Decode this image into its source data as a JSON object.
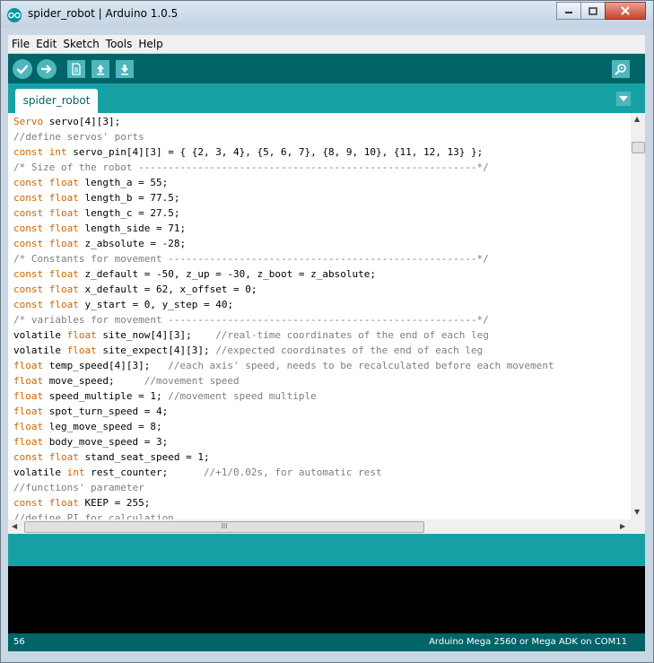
{
  "window": {
    "title": "spider_robot | Arduino 1.0.5",
    "icon": "arduino-logo-icon"
  },
  "window_buttons": {
    "minimize": "minimize-icon",
    "maximize": "maximize-icon",
    "close": "close-icon"
  },
  "menu": [
    "File",
    "Edit",
    "Sketch",
    "Tools",
    "Help"
  ],
  "toolbar": {
    "buttons": [
      "verify-icon",
      "upload-icon",
      "new-icon",
      "open-icon",
      "save-icon"
    ],
    "serial_monitor": "serial-monitor-icon"
  },
  "tabs": [
    {
      "label": "spider_robot"
    }
  ],
  "colors": {
    "accent": "#006468",
    "tab_strip": "#17a1a5",
    "keyword": "#cc6600",
    "comment": "#7e7e7e"
  },
  "code": [
    [
      {
        "t": "Servo",
        "c": "kw"
      },
      {
        "t": " servo[4][3];"
      }
    ],
    [
      {
        "t": "//define servos' ports",
        "c": "cm"
      }
    ],
    [
      {
        "t": "const",
        "c": "kw"
      },
      {
        "t": " "
      },
      {
        "t": "int",
        "c": "kw"
      },
      {
        "t": " servo_pin[4][3] = { {2, 3, 4}, {5, 6, 7}, {8, 9, 10}, {11, 12, 13} };"
      }
    ],
    [
      {
        "t": "/* Size of the robot ---------------------------------------------------------*/",
        "c": "cm"
      }
    ],
    [
      {
        "t": "const",
        "c": "kw"
      },
      {
        "t": " "
      },
      {
        "t": "float",
        "c": "kw"
      },
      {
        "t": " length_a = 55;"
      }
    ],
    [
      {
        "t": "const",
        "c": "kw"
      },
      {
        "t": " "
      },
      {
        "t": "float",
        "c": "kw"
      },
      {
        "t": " length_b = 77.5;"
      }
    ],
    [
      {
        "t": "const",
        "c": "kw"
      },
      {
        "t": " "
      },
      {
        "t": "float",
        "c": "kw"
      },
      {
        "t": " length_c = 27.5;"
      }
    ],
    [
      {
        "t": "const",
        "c": "kw"
      },
      {
        "t": " "
      },
      {
        "t": "float",
        "c": "kw"
      },
      {
        "t": " length_side = 71;"
      }
    ],
    [
      {
        "t": "const",
        "c": "kw"
      },
      {
        "t": " "
      },
      {
        "t": "float",
        "c": "kw"
      },
      {
        "t": " z_absolute = -28;"
      }
    ],
    [
      {
        "t": "/* Constants for movement ----------------------------------------------------*/",
        "c": "cm"
      }
    ],
    [
      {
        "t": "const",
        "c": "kw"
      },
      {
        "t": " "
      },
      {
        "t": "float",
        "c": "kw"
      },
      {
        "t": " z_default = -50, z_up = -30, z_boot = z_absolute;"
      }
    ],
    [
      {
        "t": "const",
        "c": "kw"
      },
      {
        "t": " "
      },
      {
        "t": "float",
        "c": "kw"
      },
      {
        "t": " x_default = 62, x_offset = 0;"
      }
    ],
    [
      {
        "t": "const",
        "c": "kw"
      },
      {
        "t": " "
      },
      {
        "t": "float",
        "c": "kw"
      },
      {
        "t": " y_start = 0, y_step = 40;"
      }
    ],
    [
      {
        "t": "/* variables for movement ----------------------------------------------------*/",
        "c": "cm"
      }
    ],
    [
      {
        "t": "volatile "
      },
      {
        "t": "float",
        "c": "kw"
      },
      {
        "t": " site_now[4][3];    "
      },
      {
        "t": "//real-time coordinates of the end of each leg",
        "c": "cm"
      }
    ],
    [
      {
        "t": "volatile "
      },
      {
        "t": "float",
        "c": "kw"
      },
      {
        "t": " site_expect[4][3]; "
      },
      {
        "t": "//expected coordinates of the end of each leg",
        "c": "cm"
      }
    ],
    [
      {
        "t": "float",
        "c": "kw"
      },
      {
        "t": " temp_speed[4][3];   "
      },
      {
        "t": "//each axis' speed, needs to be recalculated before each movement",
        "c": "cm"
      }
    ],
    [
      {
        "t": "float",
        "c": "kw"
      },
      {
        "t": " move_speed;     "
      },
      {
        "t": "//movement speed",
        "c": "cm"
      }
    ],
    [
      {
        "t": "float",
        "c": "kw"
      },
      {
        "t": " speed_multiple = 1; "
      },
      {
        "t": "//movement speed multiple",
        "c": "cm"
      }
    ],
    [
      {
        "t": "float",
        "c": "kw"
      },
      {
        "t": " spot_turn_speed = 4;"
      }
    ],
    [
      {
        "t": "float",
        "c": "kw"
      },
      {
        "t": " leg_move_speed = 8;"
      }
    ],
    [
      {
        "t": "float",
        "c": "kw"
      },
      {
        "t": " body_move_speed = 3;"
      }
    ],
    [
      {
        "t": "const",
        "c": "kw"
      },
      {
        "t": " "
      },
      {
        "t": "float",
        "c": "kw"
      },
      {
        "t": " stand_seat_speed = 1;"
      }
    ],
    [
      {
        "t": "volatile "
      },
      {
        "t": "int",
        "c": "kw"
      },
      {
        "t": " rest_counter;      "
      },
      {
        "t": "//+1/0.02s, for automatic rest",
        "c": "cm"
      }
    ],
    [
      {
        "t": "//functions' parameter",
        "c": "cm"
      }
    ],
    [
      {
        "t": "const",
        "c": "kw"
      },
      {
        "t": " "
      },
      {
        "t": "float",
        "c": "kw"
      },
      {
        "t": " KEEP = 255;"
      }
    ],
    [
      {
        "t": "//define PI for calculation",
        "c": "cm"
      }
    ]
  ],
  "scrollbars": {
    "hthumb_grip": "lll"
  },
  "status": {
    "line": "56",
    "board": "Arduino Mega 2560 or Mega ADK on COM11"
  }
}
